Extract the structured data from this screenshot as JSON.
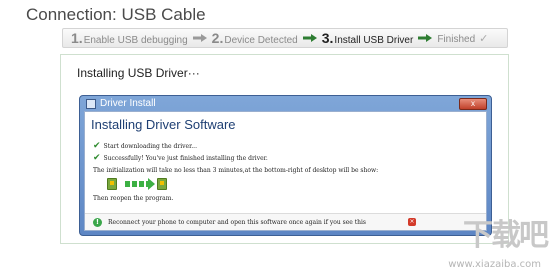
{
  "header": {
    "title": "Connection: USB Cable"
  },
  "steps": [
    {
      "num": "1.",
      "label": "Enable USB debugging",
      "state": "done"
    },
    {
      "num": "2.",
      "label": "Device Detected",
      "state": "done"
    },
    {
      "num": "3.",
      "label": "Install USB Driver",
      "state": "active"
    },
    {
      "num": "",
      "label": "Finished",
      "state": "pending"
    }
  ],
  "colors": {
    "arrow_done": "#9a9a9a",
    "arrow_active": "#2e7d32",
    "window_frame": "#5d86c4",
    "accent_green": "#3cb043"
  },
  "panel": {
    "title": "Installing USB Driver···"
  },
  "dialog": {
    "caption": "Driver Install",
    "close_label": "x",
    "heading": "Installing Driver Software",
    "lines": [
      "Start downloading the driver...",
      "Successfully! You've just finished installing the driver.",
      "The initialization will take no less than 3 minutes,at the bottom-right of desktop will be show:"
    ],
    "after_icons": "Then reopen the program.",
    "footer": "Reconnect your phone to computer and open this software once again if you see this"
  },
  "watermark": {
    "logo": "下载吧",
    "url": "www.xiazaiba.com"
  }
}
